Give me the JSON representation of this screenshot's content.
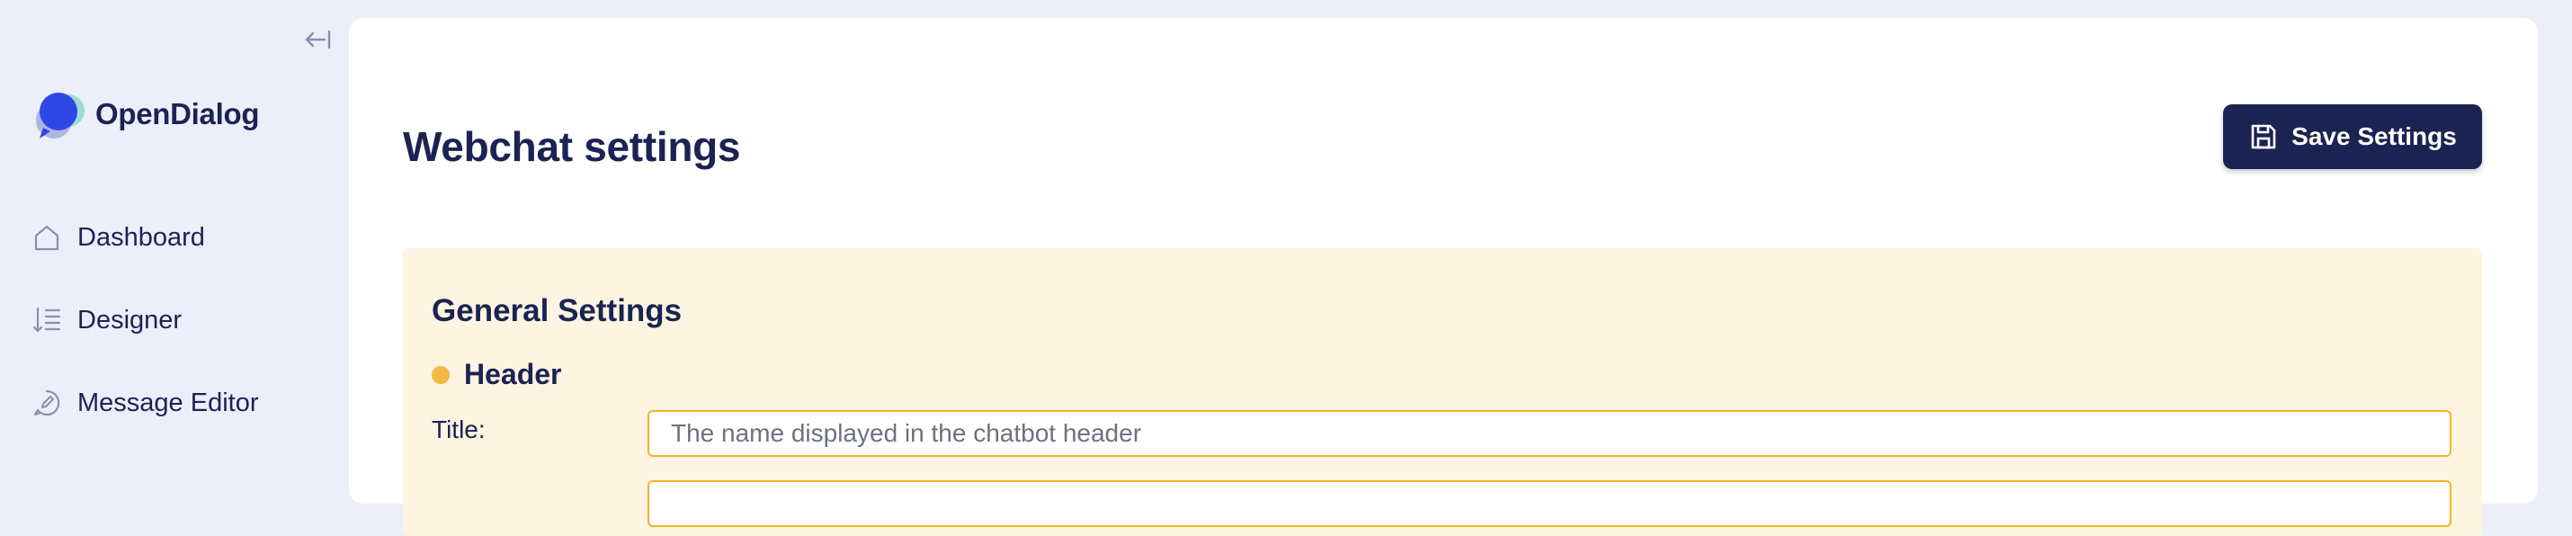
{
  "app": {
    "name": "OpenDialog"
  },
  "sidebar": {
    "collapse_icon": "collapse-left-icon",
    "items": [
      {
        "label": "Dashboard",
        "icon": "home-icon"
      },
      {
        "label": "Designer",
        "icon": "sort-list-icon"
      },
      {
        "label": "Message Editor",
        "icon": "message-edit-icon"
      }
    ]
  },
  "main": {
    "title": "Webchat settings",
    "save_button": {
      "label": "Save Settings",
      "icon": "floppy-disk-icon"
    }
  },
  "general_settings": {
    "title": "General Settings",
    "header_section": {
      "title": "Header",
      "status_color": "#f5b841",
      "title_field": {
        "label": "Title:",
        "value": "",
        "placeholder": "The name displayed in the chatbot header"
      }
    }
  },
  "colors": {
    "primary": "#1b2352",
    "sidebar_bg": "#eceef9",
    "panel_bg": "#fdf4e1",
    "input_border": "#f0b429"
  }
}
